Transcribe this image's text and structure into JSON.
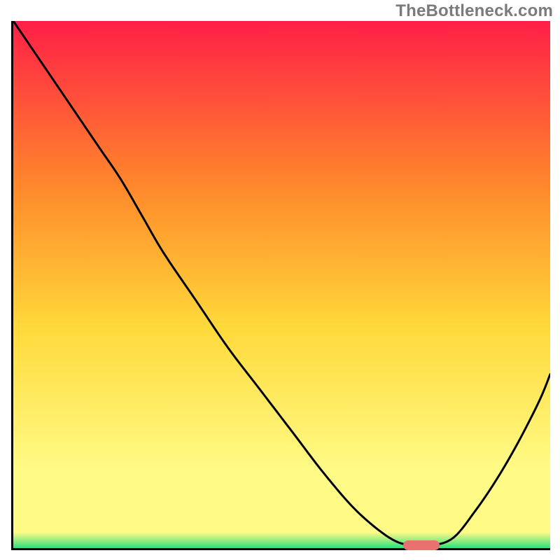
{
  "brand": {
    "watermark": "TheBottleneck.com"
  },
  "colors": {
    "gradient_top": "#ff1f47",
    "gradient_mid_upper": "#ff8a2b",
    "gradient_mid": "#ffd93a",
    "gradient_lower": "#fffb86",
    "gradient_bottom": "#2fe07d",
    "curve": "#000000",
    "marker": "#e9716f",
    "axis": "#000000"
  },
  "chart_data": {
    "type": "line",
    "title": "",
    "xlabel": "",
    "ylabel": "",
    "x": [
      0.0,
      0.04,
      0.08,
      0.12,
      0.16,
      0.2,
      0.24,
      0.28,
      0.34,
      0.4,
      0.46,
      0.52,
      0.58,
      0.64,
      0.7,
      0.74,
      0.78,
      0.82,
      0.86,
      0.9,
      0.94,
      0.98,
      1.0
    ],
    "y": [
      1.0,
      0.94,
      0.88,
      0.82,
      0.76,
      0.7,
      0.63,
      0.56,
      0.47,
      0.38,
      0.3,
      0.22,
      0.14,
      0.07,
      0.02,
      0.005,
      0.005,
      0.02,
      0.07,
      0.13,
      0.2,
      0.28,
      0.33
    ],
    "xlim": [
      0,
      1
    ],
    "ylim": [
      0,
      1
    ],
    "series": [
      {
        "name": "bottleneck-curve",
        "x_key": "x",
        "y_key": "y"
      }
    ],
    "marker": {
      "x": 0.76,
      "y": 0.005
    },
    "knee": {
      "x": 0.24,
      "y": 0.7
    }
  }
}
